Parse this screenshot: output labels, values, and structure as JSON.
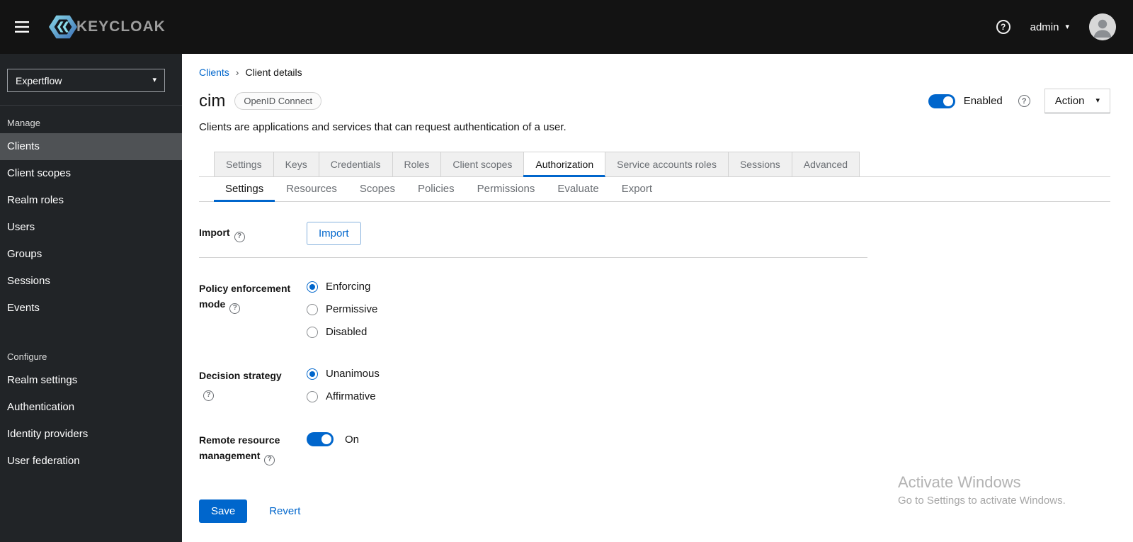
{
  "icons": {
    "help_glyph": "?",
    "caret_down_glyph": "▾",
    "breadcrumb_separator_glyph": "›"
  },
  "topbar": {
    "brand": "KEYCLOAK",
    "username": "admin"
  },
  "sidebar": {
    "realm_selector": {
      "value": "Expertflow"
    },
    "active_item": "Clients",
    "sections": [
      {
        "label": "Manage",
        "items": [
          {
            "label": "Clients"
          },
          {
            "label": "Client scopes"
          },
          {
            "label": "Realm roles"
          },
          {
            "label": "Users"
          },
          {
            "label": "Groups"
          },
          {
            "label": "Sessions"
          },
          {
            "label": "Events"
          }
        ]
      },
      {
        "label": "Configure",
        "items": [
          {
            "label": "Realm settings"
          },
          {
            "label": "Authentication"
          },
          {
            "label": "Identity providers"
          },
          {
            "label": "User federation"
          }
        ]
      }
    ]
  },
  "main": {
    "breadcrumb": {
      "parent": "Clients",
      "current": "Client details"
    },
    "header": {
      "title": "cim",
      "badge": "OpenID Connect",
      "enabled_toggle": {
        "label": "Enabled",
        "state": "on"
      },
      "action_button": "Action",
      "description": "Clients are applications and services that can request authentication of a user."
    },
    "active_tab": "Authorization",
    "tabs": [
      {
        "label": "Settings"
      },
      {
        "label": "Keys"
      },
      {
        "label": "Credentials"
      },
      {
        "label": "Roles"
      },
      {
        "label": "Client scopes"
      },
      {
        "label": "Authorization"
      },
      {
        "label": "Service accounts roles"
      },
      {
        "label": "Sessions"
      },
      {
        "label": "Advanced"
      }
    ],
    "active_subtab": "Settings",
    "subtabs": [
      {
        "label": "Settings"
      },
      {
        "label": "Resources"
      },
      {
        "label": "Scopes"
      },
      {
        "label": "Policies"
      },
      {
        "label": "Permissions"
      },
      {
        "label": "Evaluate"
      },
      {
        "label": "Export"
      }
    ],
    "form": {
      "import": {
        "label": "Import",
        "button_label": "Import"
      },
      "policy_enforcement_mode": {
        "label": "Policy enforcement mode",
        "options": [
          "Enforcing",
          "Permissive",
          "Disabled"
        ],
        "selected": "Enforcing"
      },
      "decision_strategy": {
        "label": "Decision strategy",
        "options": [
          "Unanimous",
          "Affirmative"
        ],
        "selected": "Unanimous"
      },
      "remote_resource_management": {
        "label": "Remote resource management",
        "state": "on",
        "state_label": "On"
      },
      "save_button": "Save",
      "revert_button": "Revert"
    }
  },
  "watermark": {
    "line1": "Activate Windows",
    "line2": "Go to Settings to activate Windows."
  },
  "colors": {
    "accent_blue": "#0066cc",
    "topbar_bg": "#131313",
    "sidebar_bg": "#212427",
    "sidebar_active_bg": "#4f5255",
    "tab_strip_bg": "#f0f0f0",
    "border": "#d2d2d2"
  }
}
